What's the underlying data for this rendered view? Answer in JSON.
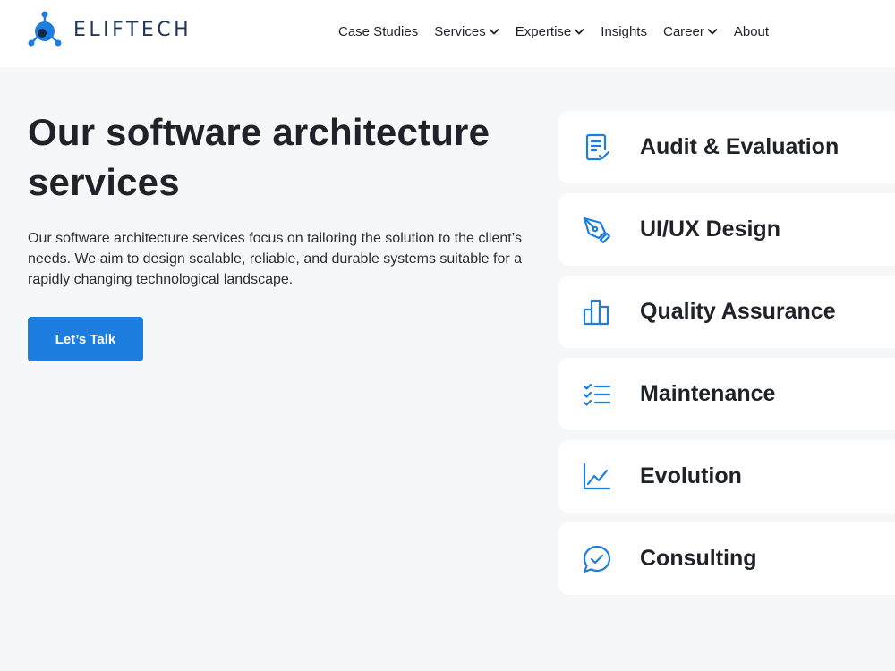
{
  "brand": {
    "name": "ELIFTECH",
    "accent_color": "#1e7ee0",
    "logo_icon": "eliftech-logo-icon"
  },
  "nav": {
    "items": [
      {
        "label": "Case Studies",
        "has_dropdown": false
      },
      {
        "label": "Services",
        "has_dropdown": true
      },
      {
        "label": "Expertise",
        "has_dropdown": true
      },
      {
        "label": "Insights",
        "has_dropdown": false
      },
      {
        "label": "Career",
        "has_dropdown": true
      },
      {
        "label": "About",
        "has_dropdown": false
      }
    ]
  },
  "hero": {
    "title": "Our software architecture services",
    "description": "Our software architecture services focus on tailoring the solution to the client’s needs. We aim to design scalable, reliable, and durable systems suitable for a rapidly changing technological landscape.",
    "cta_label": "Let’s Talk"
  },
  "services": [
    {
      "label": "Audit & Evaluation",
      "icon": "document-check-icon"
    },
    {
      "label": "UI/UX Design",
      "icon": "pen-nib-icon"
    },
    {
      "label": "Quality Assurance",
      "icon": "bar-chart-icon"
    },
    {
      "label": "Maintenance",
      "icon": "checklist-icon"
    },
    {
      "label": "Evolution",
      "icon": "line-chart-icon"
    },
    {
      "label": "Consulting",
      "icon": "chat-check-icon"
    }
  ]
}
